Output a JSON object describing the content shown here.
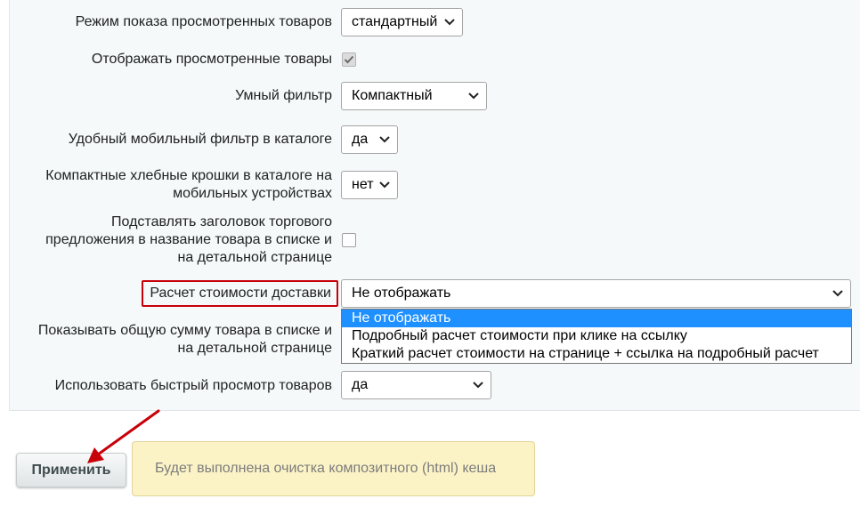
{
  "settings": {
    "viewed_mode_label": "Режим показа просмотренных товаров",
    "viewed_mode_value": "стандартный",
    "show_viewed_label": "Отображать просмотренные товары",
    "smart_filter_label": "Умный фильтр",
    "smart_filter_value": "Компактный",
    "mobile_filter_label": "Удобный мобильный фильтр в каталоге",
    "mobile_filter_value": "да",
    "compact_breadcrumbs_label": "Компактные хлебные крошки в каталоге на мобильных устройствах",
    "compact_breadcrumbs_value": "нет",
    "offer_title_label": "Подставлять заголовок торгового предложения в название товара в списке и на детальной странице",
    "delivery_cost_label": "Расчет стоимости доставки",
    "delivery_cost_value": "Не отображать",
    "delivery_cost_options": [
      "Не отображать",
      "Подробный расчет стоимости при клике на ссылку",
      "Краткий расчет стоимости на странице + ссылка на подробный расчет"
    ],
    "total_sum_label": "Показывать общую сумму товара в списке и на детальной странице",
    "quick_view_label": "Использовать быстрый просмотр товаров",
    "quick_view_value": "да"
  },
  "checkboxes": {
    "show_viewed_checked": true,
    "offer_title_checked": false
  },
  "footer": {
    "apply_label": "Применить",
    "notice_text": "Будет выполнена очистка композитного (html) кеша"
  },
  "colors": {
    "highlight_border": "#c8000a",
    "arrow": "#c8000a",
    "dropdown_selected": "#1e90ff",
    "notice_background": "#fbf3c6"
  },
  "icons": {
    "select_chevron": "chevron-down-icon",
    "checkmark": "checkmark-icon"
  }
}
